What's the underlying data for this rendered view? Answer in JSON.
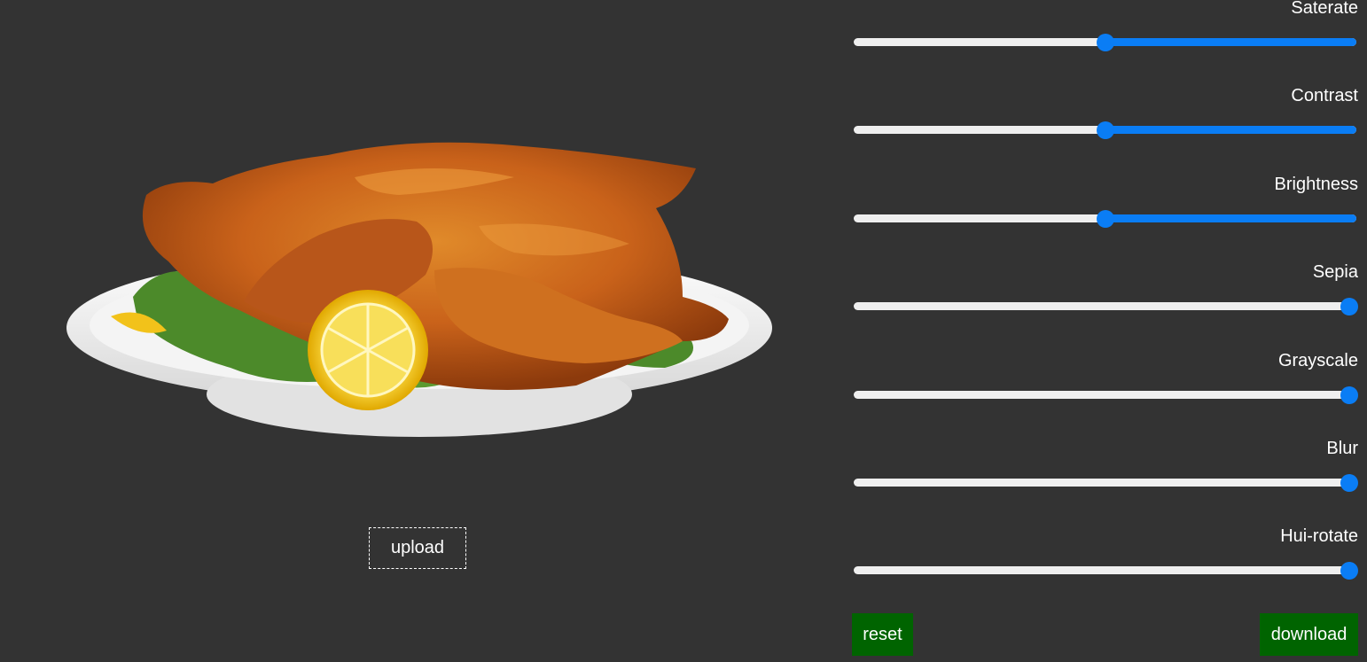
{
  "preview": {
    "image_icon": "roast-chicken-image",
    "upload_label": "upload"
  },
  "filters": [
    {
      "label": "Saterate",
      "value": 0.5,
      "fill_side": "right"
    },
    {
      "label": "Contrast",
      "value": 0.5,
      "fill_side": "right"
    },
    {
      "label": "Brightness",
      "value": 0.5,
      "fill_side": "right"
    },
    {
      "label": "Sepia",
      "value": 1.0,
      "fill_side": "right"
    },
    {
      "label": "Grayscale",
      "value": 1.0,
      "fill_side": "right"
    },
    {
      "label": "Blur",
      "value": 1.0,
      "fill_side": "right"
    },
    {
      "label": "Hui-rotate",
      "value": 1.0,
      "fill_side": "right"
    }
  ],
  "actions": {
    "reset_label": "reset",
    "download_label": "download"
  },
  "colors": {
    "background": "#333333",
    "slider_accent": "#0a7df5",
    "slider_track": "#efefef",
    "button_green": "#006400"
  }
}
